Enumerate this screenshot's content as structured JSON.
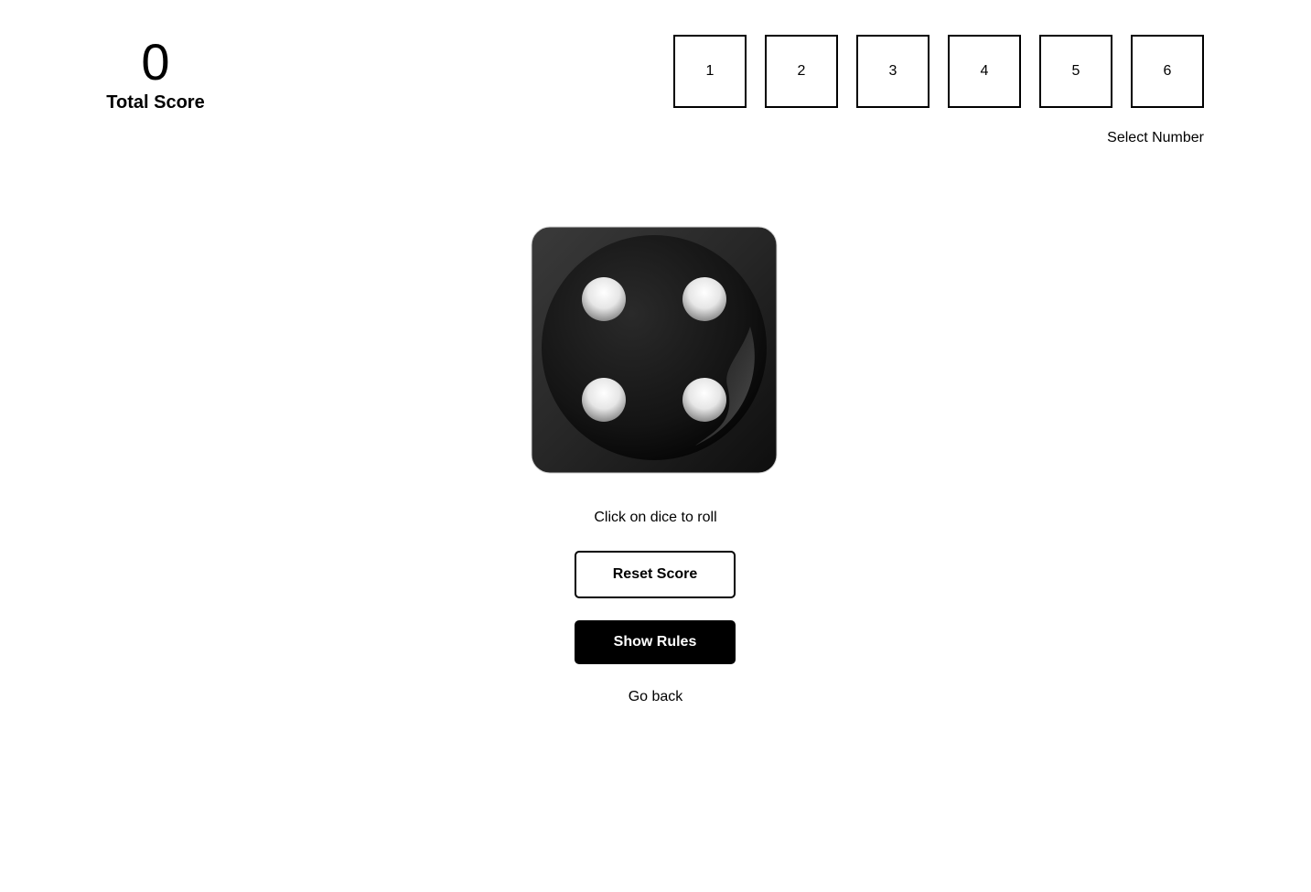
{
  "score": {
    "value": "0",
    "label": "Total Score"
  },
  "number_selector": {
    "options": [
      "1",
      "2",
      "3",
      "4",
      "5",
      "6"
    ],
    "label": "Select Number"
  },
  "dice": {
    "face": 4,
    "icon": "dice-four-icon",
    "colors": {
      "body": "#1c1c1c",
      "pip": "#f2f2f2"
    }
  },
  "hint": "Click on dice to roll",
  "buttons": {
    "reset": "Reset Score",
    "rules": "Show Rules"
  },
  "back_link": "Go back"
}
